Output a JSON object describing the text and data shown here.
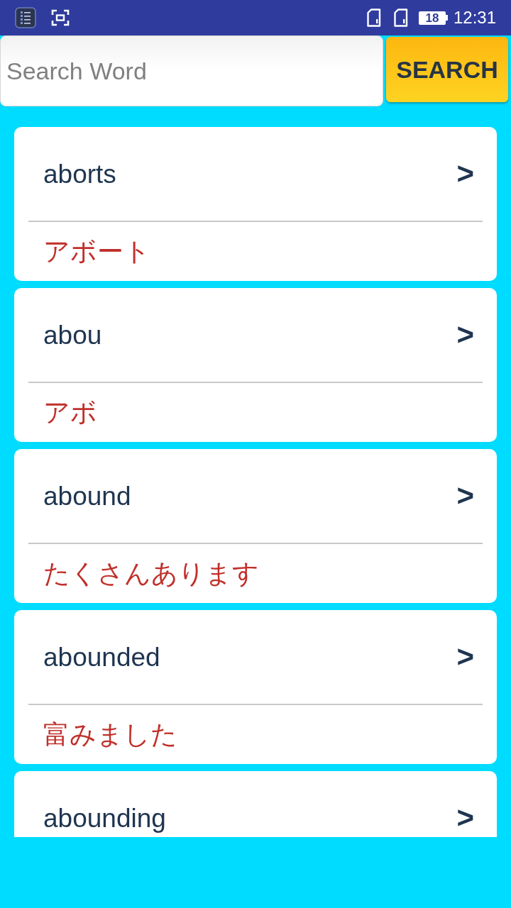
{
  "status_bar": {
    "battery": "18",
    "time": "12:31"
  },
  "search": {
    "placeholder": "Search Word",
    "button": "SEARCH"
  },
  "words": [
    {
      "word": "aborts",
      "arrow": ">",
      "meaning": "アボート"
    },
    {
      "word": "abou",
      "arrow": ">",
      "meaning": "アボ"
    },
    {
      "word": "abound",
      "arrow": ">",
      "meaning": "たくさんあります"
    },
    {
      "word": "abounded",
      "arrow": ">",
      "meaning": "富みました"
    },
    {
      "word": "abounding",
      "arrow": ">"
    }
  ]
}
